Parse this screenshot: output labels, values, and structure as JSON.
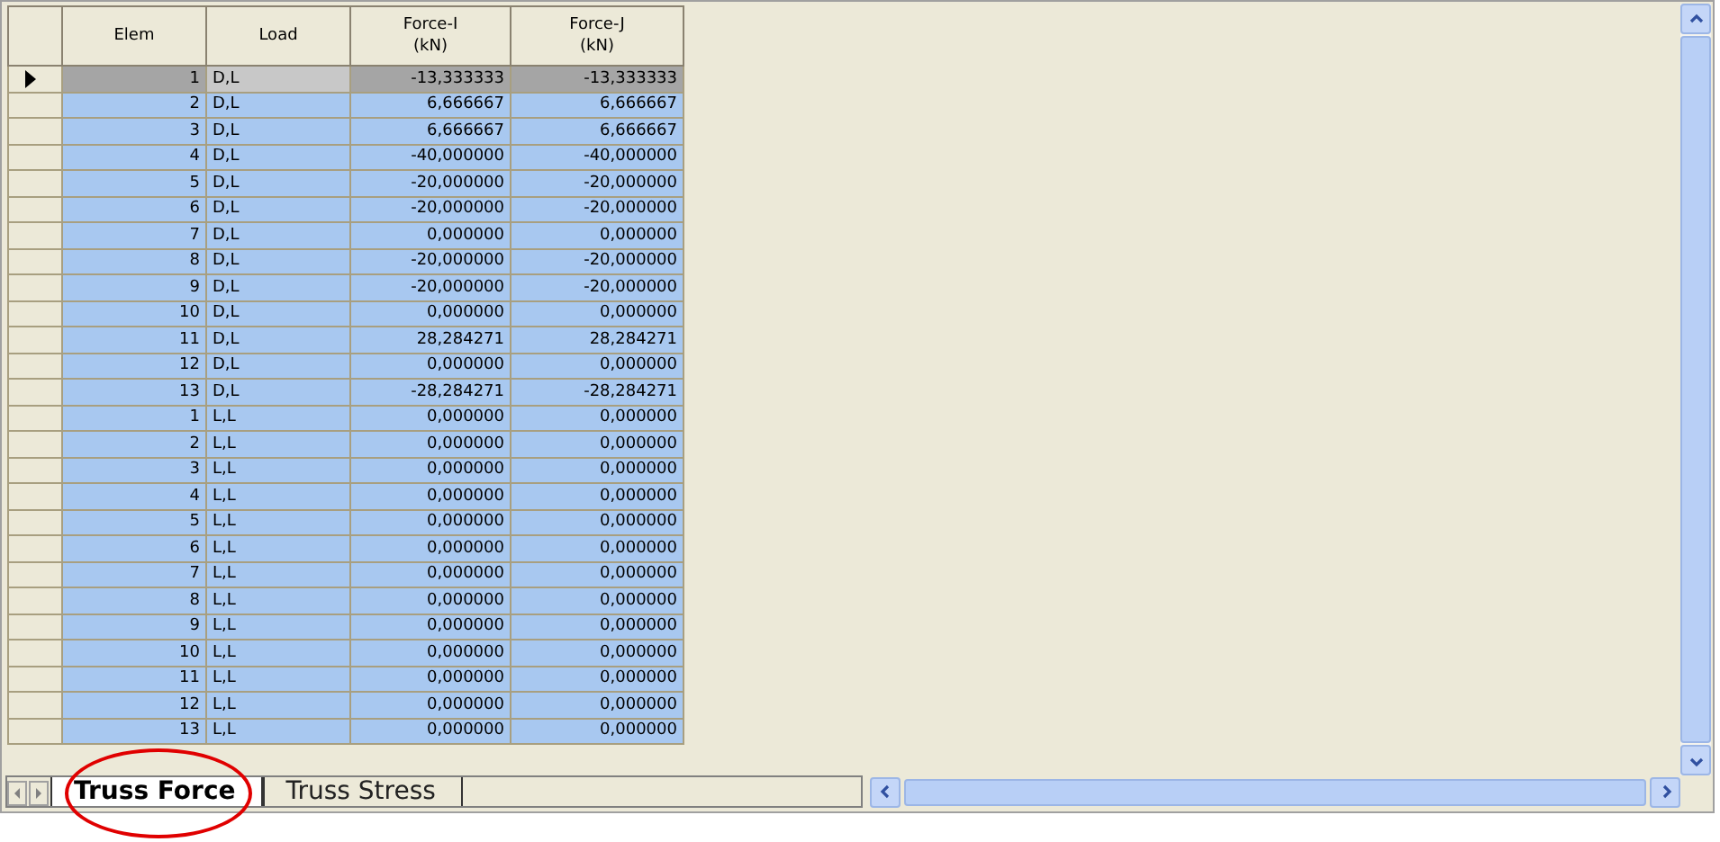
{
  "table": {
    "columns": [
      "Elem",
      "Load",
      "Force-I\n(kN)",
      "Force-J\n(kN)"
    ],
    "rows": [
      {
        "elem": "1",
        "load": "D,L",
        "force_i": "-13,333333",
        "force_j": "-13,333333",
        "selected": true
      },
      {
        "elem": "2",
        "load": "D,L",
        "force_i": "6,666667",
        "force_j": "6,666667",
        "selected": false
      },
      {
        "elem": "3",
        "load": "D,L",
        "force_i": "6,666667",
        "force_j": "6,666667",
        "selected": false
      },
      {
        "elem": "4",
        "load": "D,L",
        "force_i": "-40,000000",
        "force_j": "-40,000000",
        "selected": false
      },
      {
        "elem": "5",
        "load": "D,L",
        "force_i": "-20,000000",
        "force_j": "-20,000000",
        "selected": false
      },
      {
        "elem": "6",
        "load": "D,L",
        "force_i": "-20,000000",
        "force_j": "-20,000000",
        "selected": false
      },
      {
        "elem": "7",
        "load": "D,L",
        "force_i": "0,000000",
        "force_j": "0,000000",
        "selected": false
      },
      {
        "elem": "8",
        "load": "D,L",
        "force_i": "-20,000000",
        "force_j": "-20,000000",
        "selected": false
      },
      {
        "elem": "9",
        "load": "D,L",
        "force_i": "-20,000000",
        "force_j": "-20,000000",
        "selected": false
      },
      {
        "elem": "10",
        "load": "D,L",
        "force_i": "0,000000",
        "force_j": "0,000000",
        "selected": false
      },
      {
        "elem": "11",
        "load": "D,L",
        "force_i": "28,284271",
        "force_j": "28,284271",
        "selected": false
      },
      {
        "elem": "12",
        "load": "D,L",
        "force_i": "0,000000",
        "force_j": "0,000000",
        "selected": false
      },
      {
        "elem": "13",
        "load": "D,L",
        "force_i": "-28,284271",
        "force_j": "-28,284271",
        "selected": false
      },
      {
        "elem": "1",
        "load": "L,L",
        "force_i": "0,000000",
        "force_j": "0,000000",
        "selected": false
      },
      {
        "elem": "2",
        "load": "L,L",
        "force_i": "0,000000",
        "force_j": "0,000000",
        "selected": false
      },
      {
        "elem": "3",
        "load": "L,L",
        "force_i": "0,000000",
        "force_j": "0,000000",
        "selected": false
      },
      {
        "elem": "4",
        "load": "L,L",
        "force_i": "0,000000",
        "force_j": "0,000000",
        "selected": false
      },
      {
        "elem": "5",
        "load": "L,L",
        "force_i": "0,000000",
        "force_j": "0,000000",
        "selected": false
      },
      {
        "elem": "6",
        "load": "L,L",
        "force_i": "0,000000",
        "force_j": "0,000000",
        "selected": false
      },
      {
        "elem": "7",
        "load": "L,L",
        "force_i": "0,000000",
        "force_j": "0,000000",
        "selected": false
      },
      {
        "elem": "8",
        "load": "L,L",
        "force_i": "0,000000",
        "force_j": "0,000000",
        "selected": false
      },
      {
        "elem": "9",
        "load": "L,L",
        "force_i": "0,000000",
        "force_j": "0,000000",
        "selected": false
      },
      {
        "elem": "10",
        "load": "L,L",
        "force_i": "0,000000",
        "force_j": "0,000000",
        "selected": false
      },
      {
        "elem": "11",
        "load": "L,L",
        "force_i": "0,000000",
        "force_j": "0,000000",
        "selected": false
      },
      {
        "elem": "12",
        "load": "L,L",
        "force_i": "0,000000",
        "force_j": "0,000000",
        "selected": false
      },
      {
        "elem": "13",
        "load": "L,L",
        "force_i": "0,000000",
        "force_j": "0,000000",
        "selected": false
      }
    ]
  },
  "sheet_tabs": [
    {
      "label": "Truss Force",
      "selected": true
    },
    {
      "label": "Truss Stress",
      "selected": false
    }
  ]
}
